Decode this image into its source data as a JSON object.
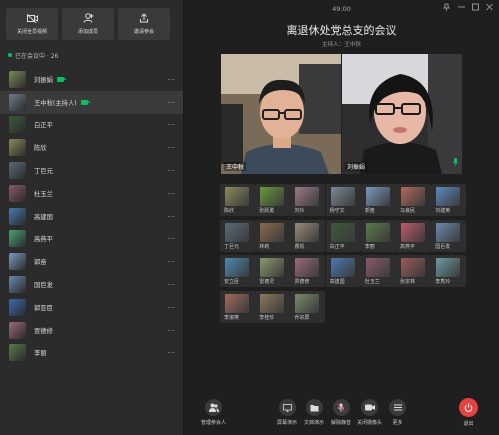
{
  "top_actions": [
    {
      "label": "关闭全员视频",
      "icon": "camera-off-icon"
    },
    {
      "label": "添加成员",
      "icon": "add-member-icon"
    },
    {
      "label": "邀请参会",
      "icon": "share-icon"
    }
  ],
  "count_label": "已在会议中 · 26",
  "participants": [
    {
      "name": "刘振娟",
      "camera": true,
      "color": "#7a8a5a"
    },
    {
      "name": "王中秋(主持人)",
      "camera": true,
      "color": "#6d7d8c",
      "selected": true
    },
    {
      "name": "白正平",
      "camera": false,
      "color": "#3c5a3a"
    },
    {
      "name": "陈欣",
      "camera": false,
      "color": "#8c8a5a"
    },
    {
      "name": "丁巨元",
      "camera": false,
      "color": "#5a6a7a"
    },
    {
      "name": "杜玉兰",
      "camera": false,
      "color": "#8a5a6a"
    },
    {
      "name": "高建国",
      "camera": false,
      "color": "#4a7ab0"
    },
    {
      "name": "高燕平",
      "camera": false,
      "color": "#4aa07a"
    },
    {
      "name": "郭奋",
      "camera": false,
      "color": "#7a9ac0"
    },
    {
      "name": "国巨发",
      "camera": false,
      "color": "#6a8ab0"
    },
    {
      "name": "郭亚臣",
      "camera": false,
      "color": "#3a6ab0"
    },
    {
      "name": "贾德修",
      "camera": false,
      "color": "#9a6a7a"
    },
    {
      "name": "李丽",
      "camera": false,
      "color": "#5a7a4a"
    }
  ],
  "timer": "49:00",
  "meeting_title": "离退休处党总支的会议",
  "host_line": "主持人：王中秋",
  "videos": [
    {
      "label": "王中秋"
    },
    {
      "label": "刘振娟"
    }
  ],
  "tiles": [
    {
      "name": "陈欣",
      "color": "#8c8a5a"
    },
    {
      "name": "张跃勇",
      "color": "#6a9a3a"
    },
    {
      "name": "刘玲",
      "color": "#9a7a8a"
    },
    {
      "name": "杨守文",
      "color": "#7a8a9a"
    },
    {
      "name": "郭奋",
      "color": "#7a9ac0"
    },
    {
      "name": "马良民",
      "color": "#b06a5a"
    },
    {
      "name": "刘建英",
      "color": "#5a8ac0"
    },
    {
      "name": "丁巨元",
      "color": "#5a6a7a"
    },
    {
      "name": "林莉",
      "color": "#8a6a4a"
    },
    {
      "name": "曹凯",
      "color": "#9a8a7a"
    },
    {
      "name": "白正平",
      "color": "#3c5a3a"
    },
    {
      "name": "李丽",
      "color": "#5a7a4a"
    },
    {
      "name": "高燕平",
      "color": "#c05a6a"
    },
    {
      "name": "国巨发",
      "color": "#6a8ab0"
    },
    {
      "name": "安立臣",
      "color": "#4a8ab0"
    },
    {
      "name": "雷德灵",
      "color": "#8a9a6a"
    },
    {
      "name": "贾德修",
      "color": "#9a6a7a"
    },
    {
      "name": "高建国",
      "color": "#4a7ab0"
    },
    {
      "name": "杜玉兰",
      "color": "#8a5a6a"
    },
    {
      "name": "张宗林",
      "color": "#9a5a5a"
    },
    {
      "name": "李秀玲",
      "color": "#6a9aa0"
    },
    {
      "name": "李淑英",
      "color": "#a06a5a"
    },
    {
      "name": "李桂珍",
      "color": "#8a7a5a"
    },
    {
      "name": "乔宗屏",
      "color": "#7a8a6a"
    }
  ],
  "bottom": {
    "manage": "管理参会人",
    "screen_share": "屏幕演示",
    "doc_share": "文档演示",
    "mute": "解除静音",
    "camera": "关闭摄像头",
    "more": "更多",
    "leave": "退出"
  }
}
